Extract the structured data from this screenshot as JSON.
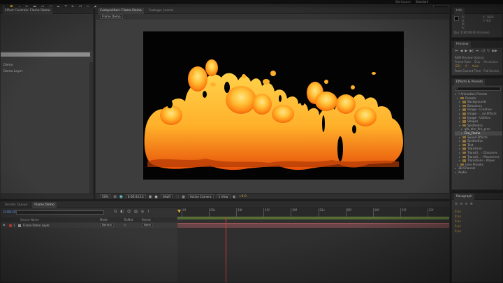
{
  "menubar": {
    "workspace_label": "Workspace",
    "workspace_value": "Standard",
    "search_placeholder": "Search Help"
  },
  "project_panel": {
    "tab_label": "Effect Controls: Flame Demo",
    "items": [
      "Demo",
      "Demo Layer"
    ]
  },
  "composition_panel": {
    "tab_label": "Composition: Flame Demo",
    "footage_tab": "Footage: (none)",
    "comp_name_tab": "Flame Demo",
    "zoom": "50%",
    "timecode": "0:00:03:13",
    "resolution": "(Half)",
    "camera": "Active Camera",
    "views": "1 View",
    "exposure": "+0.0",
    "bpc": "8 bpc"
  },
  "info_panel": {
    "tab_label": "Info",
    "values": [
      "R:",
      "G:",
      "B:",
      "A:"
    ],
    "coords": [
      "X: 1868",
      "Y: 402"
    ],
    "duration": "Dur: 0:00:06:00 (Frames)"
  },
  "preview_panel": {
    "tab_label": "Preview",
    "ram_options": "RAM Preview Options",
    "frame_rate_label": "Frame Rate",
    "frame_rate_value": "(25)",
    "skip_label": "Skip",
    "skip_value": "0",
    "resolution_label": "Resolution",
    "resolution_value": "Auto",
    "from_current": "From Current Time",
    "full_screen": "Full Screen"
  },
  "effects_panel": {
    "tab_label": "Effects & Presets",
    "search_value": "",
    "tree": [
      {
        "label": "* Animation Presets",
        "level": 0,
        "open": true,
        "folder": false
      },
      {
        "label": "Presets",
        "level": 1,
        "open": true,
        "folder": true
      },
      {
        "label": "Backgrounds",
        "level": 2,
        "open": false,
        "folder": true
      },
      {
        "label": "Behaviors",
        "level": 2,
        "open": false,
        "folder": true
      },
      {
        "label": "Image - Creative",
        "level": 2,
        "open": false,
        "folder": true
      },
      {
        "label": "Image - ...ial Effects",
        "level": 2,
        "open": false,
        "folder": true
      },
      {
        "label": "Image - Utilities",
        "level": 2,
        "open": false,
        "folder": true
      },
      {
        "label": "Shapes",
        "level": 2,
        "open": false,
        "folder": true
      },
      {
        "label": "Synthetics",
        "level": 2,
        "open": true,
        "folder": true
      },
      {
        "label": "gfx_elm_fire_pres",
        "level": 3,
        "open": false,
        "folder": false
      },
      {
        "label": "Fire_Flame",
        "level": 3,
        "open": false,
        "folder": false,
        "selected": true
      },
      {
        "label": "Sound Effects",
        "level": 2,
        "open": false,
        "folder": true
      },
      {
        "label": "Synthetics",
        "level": 2,
        "open": false,
        "folder": true
      },
      {
        "label": "Text",
        "level": 2,
        "open": false,
        "folder": true
      },
      {
        "label": "Transform",
        "level": 2,
        "open": false,
        "folder": true
      },
      {
        "label": "Transiti... - Dissolves",
        "level": 2,
        "open": false,
        "folder": true
      },
      {
        "label": "Transiti... - Movement",
        "level": 2,
        "open": false,
        "folder": true
      },
      {
        "label": "Transitions - Wipes",
        "level": 2,
        "open": false,
        "folder": true
      },
      {
        "label": "User Presets",
        "level": 1,
        "open": false,
        "folder": true
      },
      {
        "label": "3D Channel",
        "level": 0,
        "open": false,
        "folder": false
      },
      {
        "label": "Audio",
        "level": 0,
        "open": false,
        "folder": false
      }
    ]
  },
  "paragraph_panel": {
    "tab_label": "Paragraph",
    "values": [
      "0 px",
      "0 px",
      "0 px",
      "0 px",
      "0 px"
    ]
  },
  "timeline_panel": {
    "render_queue_tab": "Render Queue",
    "comp_tab": "Flame Demo",
    "timecode": "0:00:03:13",
    "search_placeholder": "",
    "col_source_name": "Source Name",
    "col_mode": "Mode",
    "col_trkmat": "TrkMat",
    "col_parent": "Parent",
    "layers": [
      {
        "num": "1",
        "name": "Flame Demo Layer",
        "mode": "Normal",
        "parent": "None"
      }
    ],
    "ruler": [
      "0f",
      "05s",
      "10f",
      "15f",
      "20f",
      "01s",
      "05f",
      "10f",
      "15f",
      "20f"
    ]
  },
  "colors": {
    "accent": "#d6a23a",
    "playhead": "#d83a3a",
    "workarea": "#6f8d3a",
    "panel_bg": "#3b3b3b"
  }
}
